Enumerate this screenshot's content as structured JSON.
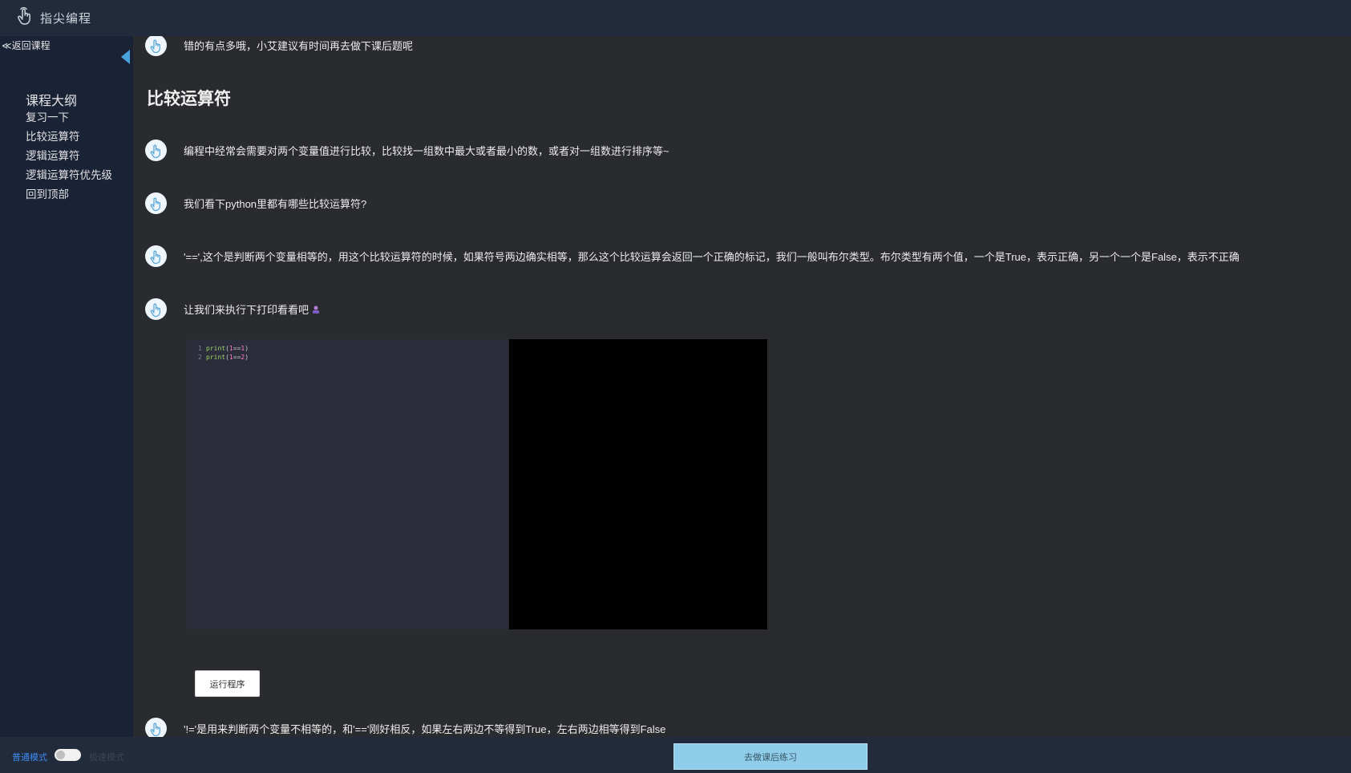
{
  "header": {
    "brand": "指尖编程"
  },
  "sidebar": {
    "back_label": "≪返回课程",
    "outline_title": "课程大纲",
    "items": [
      {
        "label": "复习一下"
      },
      {
        "label": "比较运算符"
      },
      {
        "label": "逻辑运算符"
      },
      {
        "label": "逻辑运算符优先级"
      },
      {
        "label": "回到顶部"
      }
    ]
  },
  "content": {
    "messages": [
      "错的有点多哦，小艾建议有时间再去做下课后题呢",
      "编程中经常会需要对两个变量值进行比较，比较找一组数中最大或者最小的数，或者对一组数进行排序等~",
      "我们看下python里都有哪些比较运算符?",
      "'==',这个是判断两个变量相等的，用这个比较运算符的时候，如果符号两边确实相等，那么这个比较运算会返回一个正确的标记，我们一般叫布尔类型。布尔类型有两个值，一个是True，表示正确，另一个一个是False，表示不正确",
      "让我们来执行下打印看看吧",
      "'!='是用来判断两个变量不相等的，和'=='刚好相反，如果左右两边不等得到True，左右两边相等得到False"
    ],
    "section_title": "比较运算符",
    "code": {
      "lines": [
        {
          "no": "1",
          "fn": "print",
          "open": "(",
          "a": "1",
          "op": "==",
          "b": "1",
          "close": ")"
        },
        {
          "no": "2",
          "fn": "print",
          "open": "(",
          "a": "1",
          "op": "==",
          "b": "2",
          "close": ")"
        }
      ]
    },
    "run_button": "运行程序"
  },
  "footer": {
    "mode_normal": "普通模式",
    "mode_other": "极速模式",
    "practice_button": "去做课后练习"
  },
  "colors": {
    "topbar": "#212b3b",
    "sidebar": "#1a2236",
    "content_bg": "#2a2b2f",
    "accent_blue": "#4aa3df",
    "practice_button": "#8fcdea"
  }
}
